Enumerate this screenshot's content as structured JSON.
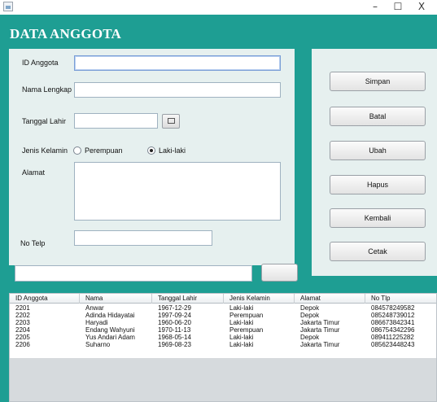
{
  "window": {
    "minimize": "–",
    "maximize": "☐",
    "close": "X"
  },
  "title": "DATA ANGGOTA",
  "form": {
    "id_label": "ID Anggota",
    "id_value": "",
    "nama_label": "Nama Lengkap",
    "nama_value": "",
    "tanggal_label": "Tanggal Lahir",
    "tanggal_value": "",
    "gender_label": "Jenis Kelamin",
    "gender_options": [
      "Perempuan",
      "Laki-laki"
    ],
    "gender_selected": "Laki-laki",
    "alamat_label": "Alamat",
    "alamat_value": "",
    "telp_label": "No Telp",
    "telp_value": ""
  },
  "buttons": [
    "Simpan",
    "Batal",
    "Ubah",
    "Hapus",
    "Kembali",
    "Cetak"
  ],
  "search": {
    "value": "",
    "button_label": ""
  },
  "table": {
    "columns": [
      "ID Anggota",
      "Nama",
      "Tanggal Lahir",
      "Jenis Kelamin",
      "Alamat",
      "No Tlp"
    ],
    "rows": [
      [
        "2201",
        "Anwar",
        "1967-12-29",
        "Laki-laki",
        "Depok",
        "084578249582"
      ],
      [
        "2202",
        "Adinda Hidayatai",
        "1997-09-24",
        "Perempuan",
        "Depok",
        "085248739012"
      ],
      [
        "2203",
        "Haryadi",
        "1960-06-20",
        "Laki-laki",
        "Jakarta Timur",
        "086673842341"
      ],
      [
        "2204",
        "Endang Wahyuni",
        "1970-11-13",
        "Perempuan",
        "Jakarta Timur",
        "086754342296"
      ],
      [
        "2205",
        "Yus Andari Adam",
        "1968-05-14",
        "Laki-laki",
        "Depok",
        "089411225282"
      ],
      [
        "2206",
        "Suharno",
        "1969-08-23",
        "Laki-laki",
        "Jakarta Timur",
        "085623448243"
      ]
    ]
  },
  "colors": {
    "frame": "#1e9e93",
    "panel": "#e6f0ef",
    "title_text": "#ffffff"
  }
}
